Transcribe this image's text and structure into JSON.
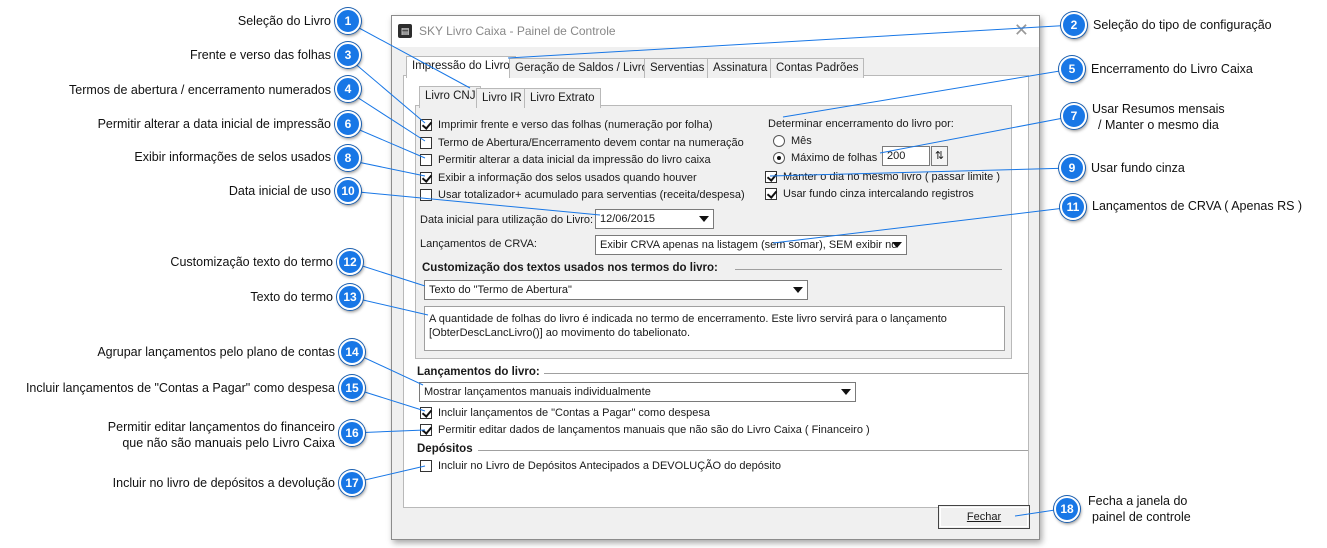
{
  "window": {
    "title": "SKY Livro Caixa - Painel de Controle",
    "icon": "document-app-icon",
    "close_glyph": "✕"
  },
  "main_tabs": [
    "Impressão do Livro",
    "Geração de Saldos / Livro",
    "Serventias",
    "Assinatura",
    "Contas Padrões"
  ],
  "sub_tabs": [
    "Livro CNJ",
    "Livro IR",
    "Livro Extrato"
  ],
  "options": {
    "frente_verso": {
      "label": "Imprimir frente e verso das folhas (numeração por folha)",
      "checked": true
    },
    "termos_numerados": {
      "label": "Termo de Abertura/Encerramento devem contar na numeração",
      "checked": false
    },
    "alterar_data": {
      "label": "Permitir alterar a data inicial da impressão do livro caixa",
      "checked": false
    },
    "selos": {
      "label": "Exibir a informação dos selos usados quando houver",
      "checked": true
    },
    "totalizador": {
      "label": "Usar totalizador+ acumulado para serventias (receita/despesa)",
      "checked": false
    }
  },
  "encerramento": {
    "heading": "Determinar encerramento do livro por:",
    "mes_label": "Mês",
    "maximo_label": "Máximo de folhas",
    "selected": "maximo",
    "maximo_value": "200",
    "spin_glyph": "⇅"
  },
  "extra_options": {
    "manter_dia": {
      "label": "Manter o dia no mesmo livro ( passar limite )",
      "checked": true
    },
    "fundo_cinza": {
      "label": "Usar fundo cinza intercalando registros",
      "checked": true
    }
  },
  "data_inicial": {
    "label": "Data inicial para utilização do Livro:",
    "value": "12/06/2015"
  },
  "crva": {
    "label": "Lançamentos de CRVA:",
    "value": "Exibir CRVA apenas na listagem (sem somar), SEM exibir no"
  },
  "customizacao": {
    "heading": "Customização dos textos usados nos termos do livro:",
    "select_value": "Texto do \"Termo de Abertura\"",
    "text": "A quantidade de folhas do livro é indicada no termo de encerramento. Este livro servirá para o lançamento\n[ObterDescLancLivro()] ao movimento do tabelionato."
  },
  "lancamentos": {
    "heading": "Lançamentos do livro:",
    "select_value": "Mostrar lançamentos manuais individualmente",
    "contas_pagar": {
      "label": "Incluir lançamentos de \"Contas a Pagar\" como despesa",
      "checked": true
    },
    "editar_dados": {
      "label": "Permitir editar dados de lançamentos manuais que não são do Livro Caixa ( Financeiro )",
      "checked": true
    }
  },
  "depositos": {
    "heading": "Depósitos",
    "devolucao": {
      "label": "Incluir no Livro de Depósitos Antecipados a DEVOLUÇÃO do depósito",
      "checked": false
    }
  },
  "close_button": "Fechar",
  "callouts": {
    "c1": {
      "number": "1",
      "text": "Seleção do Livro"
    },
    "c2": {
      "number": "2",
      "text": "Seleção do tipo de configuração"
    },
    "c3": {
      "number": "3",
      "text": "Frente e verso das folhas"
    },
    "c4": {
      "number": "4",
      "text": "Termos de abertura / encerramento numerados"
    },
    "c5": {
      "number": "5",
      "text": "Encerramento do Livro Caixa"
    },
    "c6": {
      "number": "6",
      "text": "Permitir alterar a data inicial de impressão"
    },
    "c7": {
      "number": "7",
      "text_line1": "Usar Resumos mensais",
      "text_line2": "/ Manter o mesmo dia"
    },
    "c8": {
      "number": "8",
      "text": "Exibir informações de selos usados"
    },
    "c9": {
      "number": "9",
      "text": "Usar fundo cinza"
    },
    "c10": {
      "number": "10",
      "text": "Data inicial de uso"
    },
    "c11": {
      "number": "11",
      "text": "Lançamentos de CRVA ( Apenas RS )"
    },
    "c12": {
      "number": "12",
      "text": "Customização texto do termo"
    },
    "c13": {
      "number": "13",
      "text": "Texto do termo"
    },
    "c14": {
      "number": "14",
      "text": "Agrupar lançamentos pelo plano de contas"
    },
    "c15": {
      "number": "15",
      "text": "Incluir lançamentos de \"Contas a Pagar\" como despesa"
    },
    "c16": {
      "number": "16",
      "text_line1": "Permitir editar lançamentos do financeiro",
      "text_line2": "que não são manuais pelo Livro Caixa"
    },
    "c17": {
      "number": "17",
      "text": "Incluir no livro de depósitos a devolução"
    },
    "c18": {
      "number": "18",
      "text_line1": "Fecha a janela do",
      "text_line2": "painel de controle"
    }
  },
  "colors": {
    "badge": "#1877e6",
    "leader": "#1877e6"
  }
}
